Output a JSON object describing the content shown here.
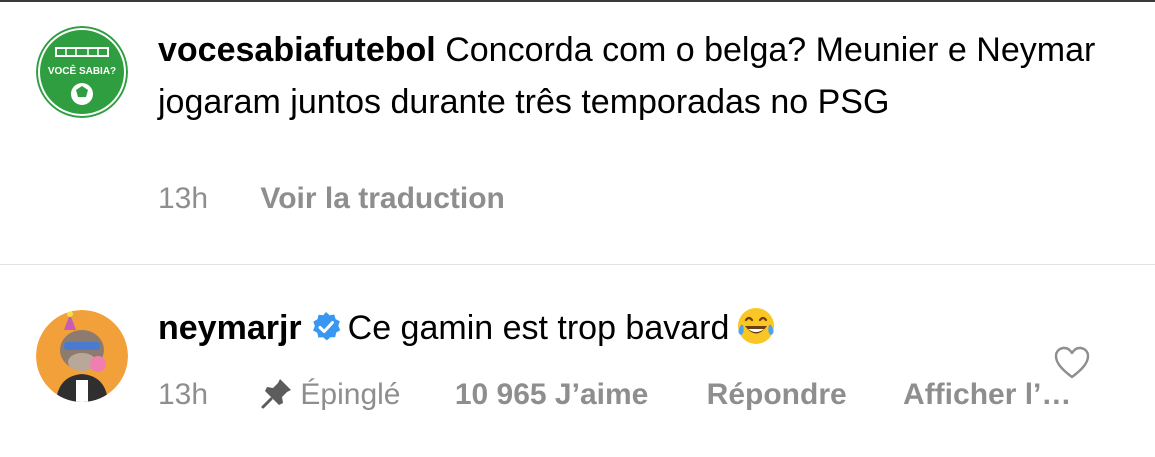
{
  "comments": [
    {
      "username": "vocesabiafutebol",
      "text": "Concorda com o belga? Meunier e Neymar jogaram juntos durante três temporadas no PSG",
      "time": "13h",
      "translate_label": "Voir la traduction",
      "avatar_text": "VOCÊ SABIA?",
      "avatar_color": "#2f9e41"
    },
    {
      "username": "neymarjr",
      "text": "Ce gamin est trop bavard",
      "emoji": "face-with-tears-of-joy",
      "time": "13h",
      "pinned_label": "Épinglé",
      "likes_label": "10 965 J’aime",
      "reply_label": "Répondre",
      "more_label": "Afficher l’…",
      "verified_color": "#3897f0",
      "avatar_color": "#f2a13a"
    }
  ]
}
